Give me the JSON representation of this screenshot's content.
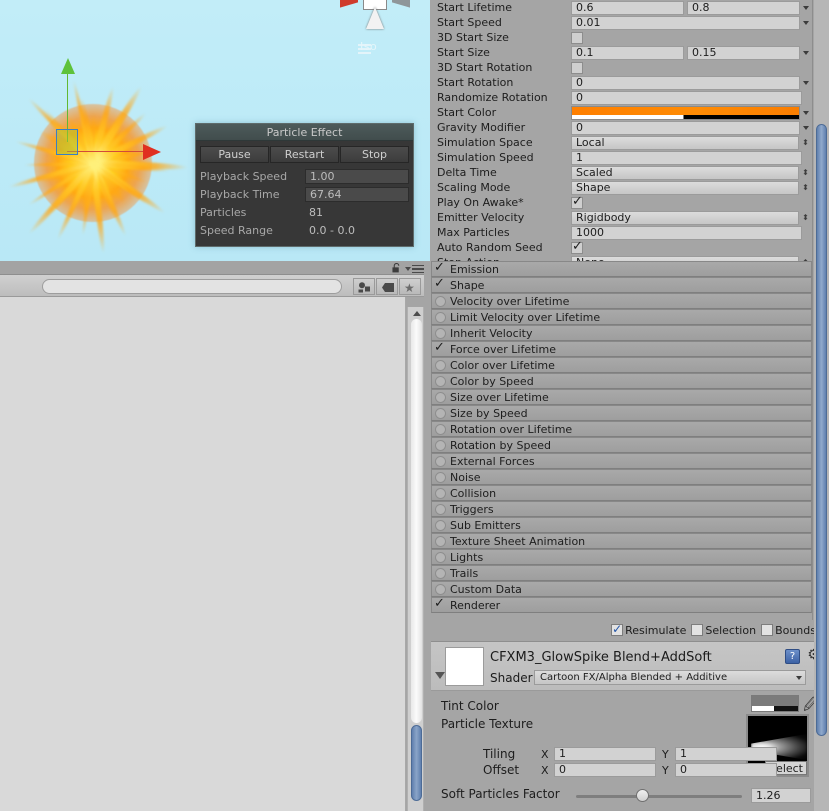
{
  "scene_view": {
    "gizmo_label": "Iso",
    "background_color": "#bfeaf7",
    "effect_name": "particle-burst"
  },
  "particle_effect_panel": {
    "title": "Particle Effect",
    "buttons": [
      {
        "name": "pause",
        "label": "Pause"
      },
      {
        "name": "restart",
        "label": "Restart"
      },
      {
        "name": "stop",
        "label": "Stop"
      }
    ],
    "rows": [
      {
        "label": "Playback Speed",
        "value": "1.00",
        "boxed": true
      },
      {
        "label": "Playback Time",
        "value": "67.64",
        "boxed": true
      },
      {
        "label": "Particles",
        "value": "81",
        "boxed": false
      },
      {
        "label": "Speed Range",
        "value": "0.0 - 0.0",
        "boxed": false
      }
    ]
  },
  "hierarchy": {
    "search": {
      "value": "",
      "placeholder": ""
    },
    "toolbar_buttons": [
      {
        "name": "filter-by-type",
        "icon": "objects-icon"
      },
      {
        "name": "filter-by-label",
        "icon": "tag-icon"
      },
      {
        "name": "favorites",
        "icon": "star-icon"
      }
    ],
    "lock_icon": "lock-open-icon",
    "menu_icon": "hamburger-menu-icon"
  },
  "inspector": {
    "properties": [
      {
        "label": "Start Lifetime",
        "type": "two-field-popup",
        "value": "0.6",
        "value2": "0.8"
      },
      {
        "label": "Start Speed",
        "type": "field-popup",
        "value": "0.01"
      },
      {
        "label": "3D Start Size",
        "type": "checkbox",
        "checked": false
      },
      {
        "label": "Start Size",
        "type": "two-field-popup",
        "value": "0.1",
        "value2": "0.15"
      },
      {
        "label": "3D Start Rotation",
        "type": "checkbox",
        "checked": false
      },
      {
        "label": "Start Rotation",
        "type": "field-popup",
        "value": "0"
      },
      {
        "label": "Randomize Rotation",
        "type": "field",
        "value": "0"
      },
      {
        "label": "Start Color",
        "type": "gradient",
        "value": "#ff7f00"
      },
      {
        "label": "Gravity Modifier",
        "type": "field-popup",
        "value": "0"
      },
      {
        "label": "Simulation Space",
        "type": "popup",
        "value": "Local"
      },
      {
        "label": "Simulation Speed",
        "type": "field",
        "value": "1"
      },
      {
        "label": "Delta Time",
        "type": "popup",
        "value": "Scaled"
      },
      {
        "label": "Scaling Mode",
        "type": "popup",
        "value": "Shape"
      },
      {
        "label": "Play On Awake*",
        "type": "checkbox",
        "checked": true
      },
      {
        "label": "Emitter Velocity",
        "type": "popup",
        "value": "Rigidbody"
      },
      {
        "label": "Max Particles",
        "type": "field",
        "value": "1000"
      },
      {
        "label": "Auto Random Seed",
        "type": "checkbox",
        "checked": true
      },
      {
        "label": "Stop Action",
        "type": "popup",
        "value": "None"
      }
    ],
    "modules": [
      {
        "label": "Emission",
        "enabled": true
      },
      {
        "label": "Shape",
        "enabled": true
      },
      {
        "label": "Velocity over Lifetime",
        "enabled": false
      },
      {
        "label": "Limit Velocity over Lifetime",
        "enabled": false
      },
      {
        "label": "Inherit Velocity",
        "enabled": false
      },
      {
        "label": "Force over Lifetime",
        "enabled": true
      },
      {
        "label": "Color over Lifetime",
        "enabled": false
      },
      {
        "label": "Color by Speed",
        "enabled": false
      },
      {
        "label": "Size over Lifetime",
        "enabled": false
      },
      {
        "label": "Size by Speed",
        "enabled": false
      },
      {
        "label": "Rotation over Lifetime",
        "enabled": false
      },
      {
        "label": "Rotation by Speed",
        "enabled": false
      },
      {
        "label": "External Forces",
        "enabled": false
      },
      {
        "label": "Noise",
        "enabled": false
      },
      {
        "label": "Collision",
        "enabled": false
      },
      {
        "label": "Triggers",
        "enabled": false
      },
      {
        "label": "Sub Emitters",
        "enabled": false
      },
      {
        "label": "Texture Sheet Animation",
        "enabled": false
      },
      {
        "label": "Lights",
        "enabled": false
      },
      {
        "label": "Trails",
        "enabled": false
      },
      {
        "label": "Custom Data",
        "enabled": false
      },
      {
        "label": "Renderer",
        "enabled": true
      }
    ],
    "resimulate_bar": [
      {
        "label": "Resimulate",
        "checked": true
      },
      {
        "label": "Selection",
        "checked": false
      },
      {
        "label": "Bounds",
        "checked": false
      }
    ]
  },
  "material": {
    "name": "CFXM3_GlowSpike Blend+AddSoft",
    "shader_label": "Shader",
    "shader_value": "Cartoon FX/Alpha Blended + Additive",
    "help_icon": "help-book-icon",
    "gear_icon": "gear-icon",
    "tint_color_label": "Tint Color",
    "particle_texture_label": "Particle Texture",
    "eyedropper_icon": "eyedropper-icon",
    "texture_select_label": "Select",
    "tiling": {
      "label": "Tiling",
      "x_label": "X",
      "x": "1",
      "y_label": "Y",
      "y": "1"
    },
    "offset": {
      "label": "Offset",
      "x_label": "X",
      "x": "0",
      "y_label": "Y",
      "y": "0"
    },
    "soft_particles": {
      "label": "Soft Particles Factor",
      "value": "1.26"
    }
  }
}
